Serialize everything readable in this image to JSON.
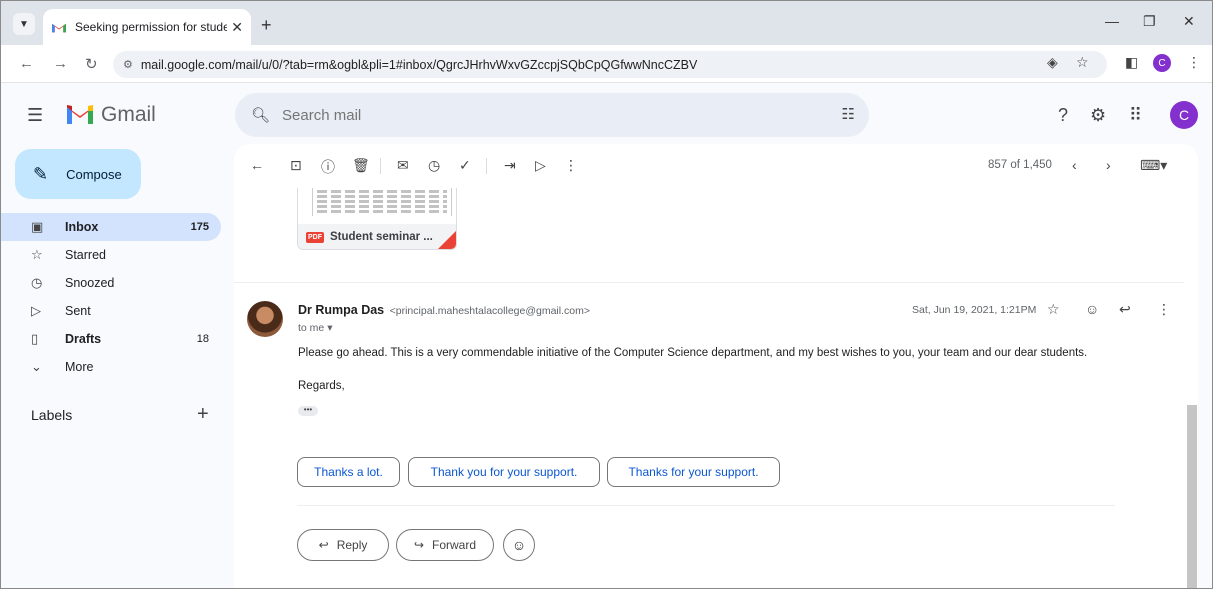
{
  "browser": {
    "tab_title": "Seeking permission for student",
    "url": "mail.google.com/mail/u/0/?tab=rm&ogbl&pli=1#inbox/QgrcJHrhvWxvGZccpjSQbCpQGfwwNncCZBV",
    "profile_initial": "C"
  },
  "gmail": {
    "brand": "Gmail",
    "search_placeholder": "Search mail",
    "account_initial": "C"
  },
  "sidebar": {
    "compose_label": "Compose",
    "items": [
      {
        "label": "Inbox",
        "count": "175",
        "icon": "inbox-icon"
      },
      {
        "label": "Starred",
        "count": "",
        "icon": "star-icon"
      },
      {
        "label": "Snoozed",
        "count": "",
        "icon": "clock-icon"
      },
      {
        "label": "Sent",
        "count": "",
        "icon": "send-icon"
      },
      {
        "label": "Drafts",
        "count": "18",
        "icon": "draft-icon"
      },
      {
        "label": "More",
        "count": "",
        "icon": "chevron-down-icon"
      }
    ],
    "labels_heading": "Labels"
  },
  "toolbar": {
    "pager": "857 of 1,450"
  },
  "attachment": {
    "name": "Student seminar ...",
    "type": "PDF"
  },
  "message": {
    "sender_name": "Dr Rumpa Das",
    "sender_email": "<principal.maheshtalacollege@gmail.com>",
    "to": "to me",
    "date": "Sat, Jun 19, 2021, 1:21PM",
    "body": "Please go ahead. This is a very commendable initiative of the Computer Science department, and my best wishes to you, your team and our dear students.",
    "signoff": "Regards,"
  },
  "smart_replies": [
    "Thanks a lot.",
    "Thank you for your support.",
    "Thanks for your support."
  ],
  "actions": {
    "reply": "Reply",
    "forward": "Forward"
  },
  "colors": {
    "compose_bg": "#c2e7ff",
    "active_nav_bg": "#d3e3fd",
    "smart_reply_text": "#0b57d0",
    "avatar": "#8430ce"
  }
}
